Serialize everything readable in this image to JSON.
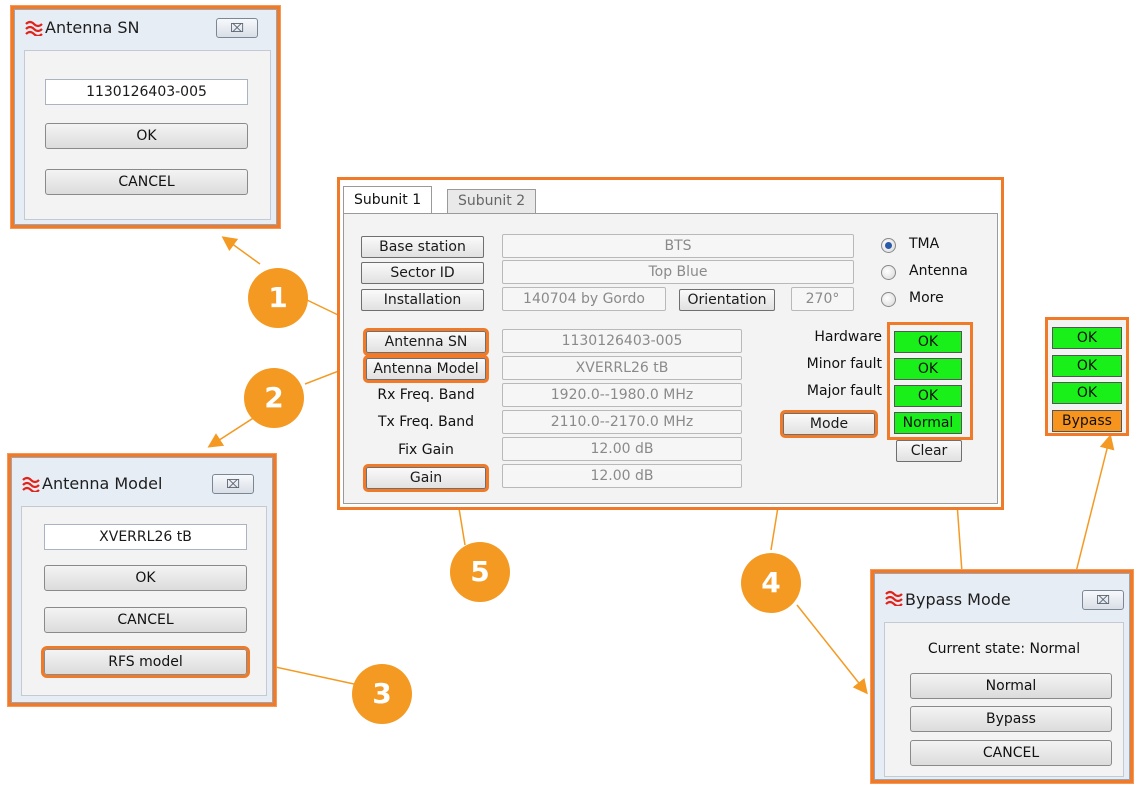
{
  "antenna_sn_dialog": {
    "title": "Antenna SN",
    "close_label": "⌧",
    "value": "1130126403-005",
    "ok_label": "OK",
    "cancel_label": "CANCEL"
  },
  "antenna_model_dialog": {
    "title": "Antenna Model",
    "close_label": "⌧",
    "value": "XVERRL26 tB",
    "ok_label": "OK",
    "cancel_label": "CANCEL",
    "rfs_label": "RFS model"
  },
  "bypass_dialog": {
    "title": "Bypass Mode",
    "close_label": "⌧",
    "current_state": "Current state: Normal",
    "normal_label": "Normal",
    "bypass_label": "Bypass",
    "cancel_label": "CANCEL"
  },
  "main": {
    "tabs": [
      "Subunit 1",
      "Subunit 2"
    ],
    "base_station_label": "Base station",
    "base_station_value": "BTS",
    "sector_id_label": "Sector ID",
    "sector_id_value": "Top Blue",
    "installation_label": "Installation",
    "installation_value": "140704 by Gordo",
    "orientation_label": "Orientation",
    "orientation_value": "270°",
    "radios": [
      "TMA",
      "Antenna",
      "More"
    ],
    "antenna_sn_label": "Antenna SN",
    "antenna_sn_value": "1130126403-005",
    "antenna_model_label": "Antenna Model",
    "antenna_model_value": "XVERRL26 tB",
    "rx_label": "Rx Freq. Band",
    "rx_value": "1920.0--1980.0 MHz",
    "tx_label": "Tx Freq. Band",
    "tx_value": "2110.0--2170.0 MHz",
    "fix_gain_label": "Fix Gain",
    "fix_gain_value": "12.00 dB",
    "gain_label": "Gain",
    "gain_value": "12.00 dB",
    "hardware_label": "Hardware",
    "minor_label": "Minor fault",
    "major_label": "Major fault",
    "mode_label": "Mode",
    "clear_label": "Clear",
    "status": [
      "OK",
      "OK",
      "OK",
      "Normal"
    ]
  },
  "bypass_status": [
    "OK",
    "OK",
    "OK",
    "Bypass"
  ],
  "badges": [
    "1",
    "2",
    "3",
    "4",
    "5"
  ],
  "colors": {
    "accent": "#f07a28",
    "ok": "#19f019",
    "bypass": "#f7941d",
    "badge": "#f49a22"
  }
}
